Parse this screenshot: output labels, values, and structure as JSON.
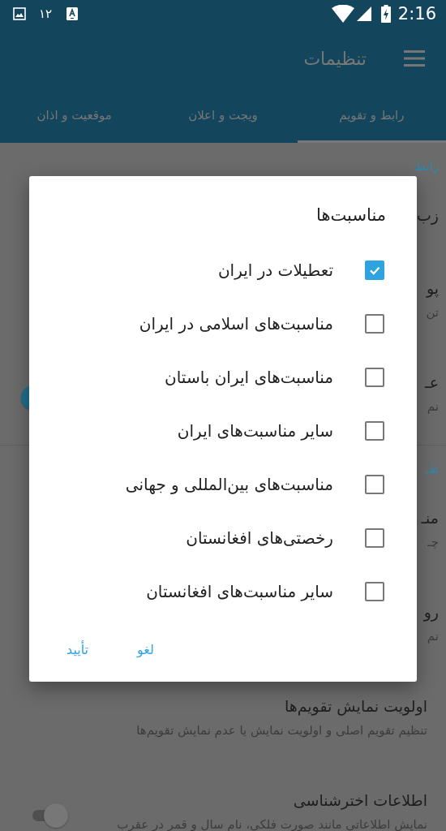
{
  "status_bar": {
    "notification_count": "۱۲",
    "time": "2:16"
  },
  "app_bar": {
    "title": "تنظیمات"
  },
  "tabs": [
    {
      "label": "رابط و تقویم",
      "selected": true
    },
    {
      "label": "ویجت و اعلان",
      "selected": false
    },
    {
      "label": "موقعیت و اذان",
      "selected": false
    }
  ],
  "settings": [
    {
      "kind": "header",
      "title": "رابط"
    },
    {
      "kind": "item",
      "title": "زب"
    },
    {
      "kind": "item",
      "title": "پو",
      "summary": "تن"
    },
    {
      "kind": "item",
      "title": "عـ",
      "summary": "نم",
      "switch": {
        "on": true
      }
    },
    {
      "kind": "divider"
    },
    {
      "kind": "header",
      "title": "تقـ"
    },
    {
      "kind": "item",
      "title": "منـ",
      "summary": "چـ"
    },
    {
      "kind": "item",
      "title": "رو",
      "summary": "نم"
    },
    {
      "kind": "item",
      "title": "اولویت نمایش تقویم‌ها",
      "summary": "تنظیم تقویم اصلی و اولویت نمایش یا عدم نمایش تقویم‌ها"
    },
    {
      "kind": "item",
      "title": "اطلاعات اخترشناسی",
      "summary": "نمایش اطلاعاتی مانند صورت فلکی، نام سال و قمر در عقرب",
      "switch": {
        "on": false
      }
    }
  ],
  "dialog": {
    "title": "مناسبت‌ها",
    "options": [
      {
        "label": "تعطیلات در ایران",
        "checked": true
      },
      {
        "label": "مناسبت‌های اسلامی در ایران",
        "checked": false
      },
      {
        "label": "مناسبت‌های ایران باستان",
        "checked": false
      },
      {
        "label": "سایر مناسبت‌های ایران",
        "checked": false
      },
      {
        "label": "مناسبت‌های بین‌المللی و جهانی",
        "checked": false
      },
      {
        "label": "رخصتی‌های افغانستان",
        "checked": false
      },
      {
        "label": "سایر مناسبت‌های افغانستان",
        "checked": false
      }
    ],
    "buttons": [
      "لغو",
      "تأیید"
    ]
  }
}
